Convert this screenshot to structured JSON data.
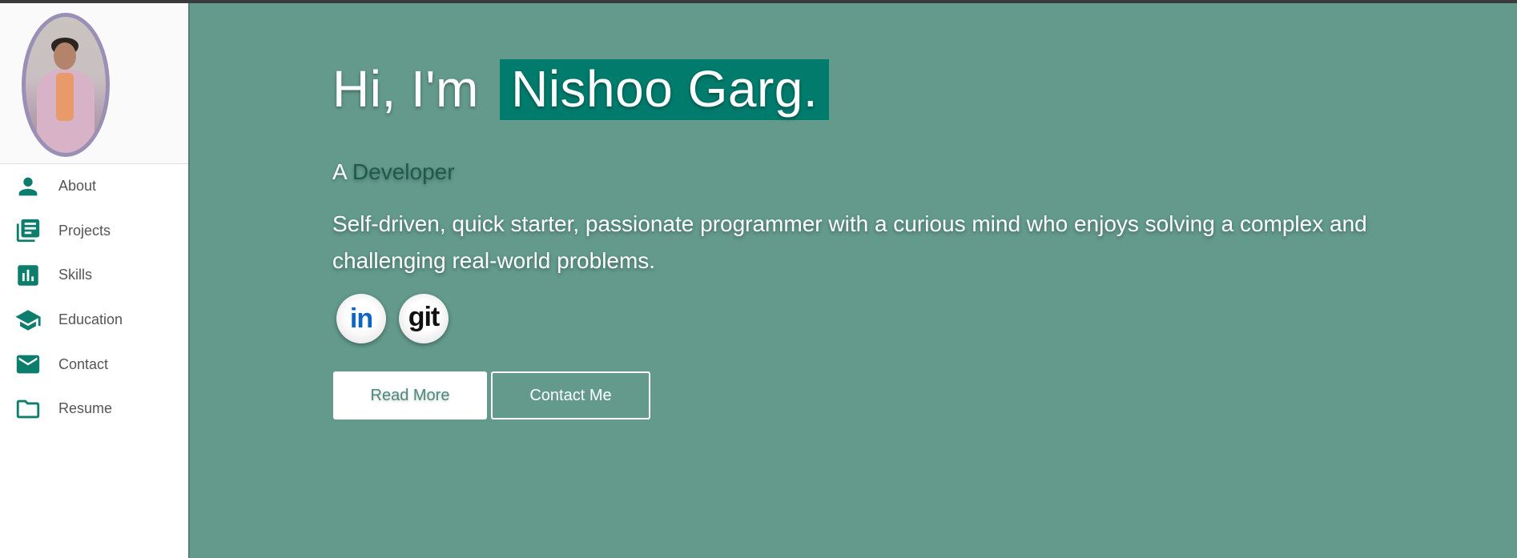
{
  "sidebar": {
    "items": [
      {
        "label": "About",
        "icon": "person-icon"
      },
      {
        "label": "Projects",
        "icon": "library-books-icon"
      },
      {
        "label": "Skills",
        "icon": "bar-chart-icon"
      },
      {
        "label": "Education",
        "icon": "graduation-cap-icon"
      },
      {
        "label": "Contact",
        "icon": "envelope-icon"
      },
      {
        "label": "Resume",
        "icon": "folder-icon"
      }
    ]
  },
  "hero": {
    "greeting": "Hi, I'm",
    "name": "Nishoo Garg.",
    "role_prefix": "A",
    "role": "Developer",
    "bio": "Self-driven, quick starter, passionate programmer with a curious mind who enjoys solving a complex and challenging real-world problems.",
    "social": {
      "linkedin": "in",
      "git": "git"
    },
    "buttons": {
      "read_more": "Read More",
      "contact": "Contact Me"
    }
  },
  "colors": {
    "accent": "#0d7d6e",
    "hero_background": "#639a8c",
    "name_highlight": "#007b6c",
    "avatar_border": "#9a8fb5"
  }
}
